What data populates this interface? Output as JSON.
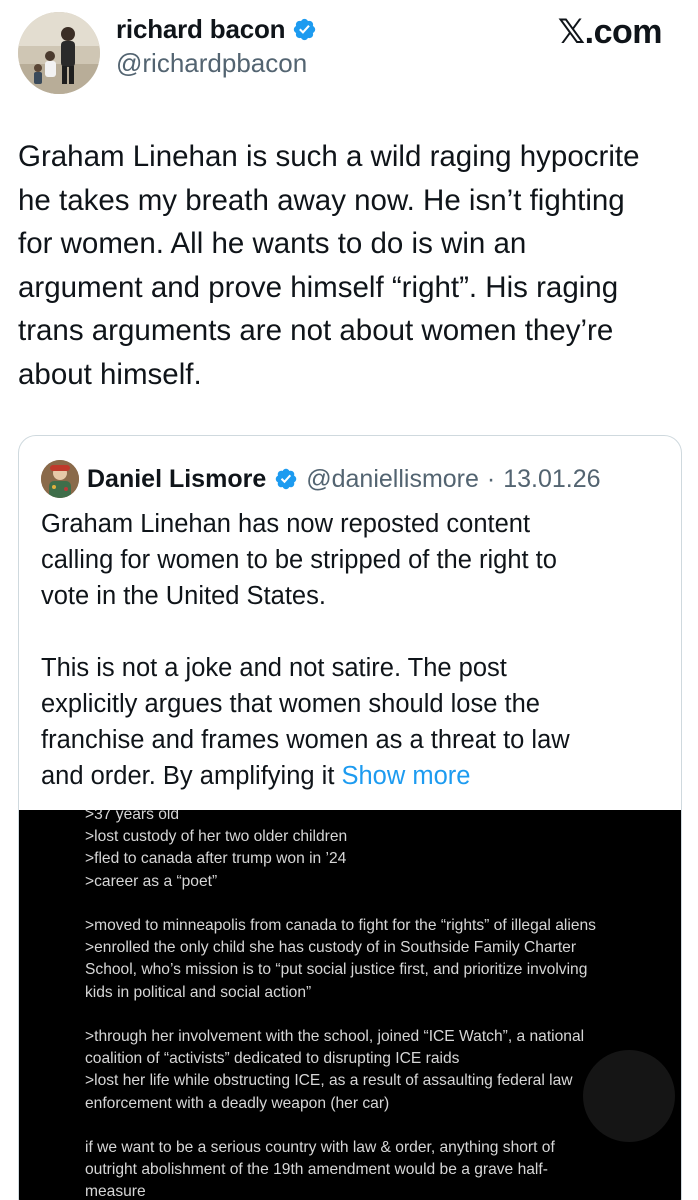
{
  "author": {
    "name": "richard bacon",
    "handle": "@richardpbacon",
    "avatar_icon": "avatar-photo-icon"
  },
  "brand": {
    "logo_text": "𝕏.com"
  },
  "tweet": {
    "text": "Graham Linehan is such a wild raging hypocrite\nhe takes my breath away now. He isn’t fighting\nfor women. All he wants to do is win an\nargument and prove himself “right”. His raging\ntrans arguments are not about women they’re\nabout himself."
  },
  "quoted": {
    "name": "Daniel Lismore",
    "handle": "@daniellismore",
    "separator": "·",
    "date": "13.01.26",
    "text": "Graham Linehan has now reposted content\ncalling for women to be stripped of the right to\nvote in the United States.\n\nThis is not a joke and not satire. The post\nexplicitly argues that women should lose the\nfranchise and frames women as a threat to law\nand order. By amplifying it ",
    "show_more": "Show more",
    "media_text": ">37 years old\n>lost custody of her two older children\n>fled to canada after trump won in ’24\n>career as a “poet”\n\n>moved to minneapolis from canada to fight for the “rights” of illegal aliens\n>enrolled the only child she has custody of in Southside Family Charter\nSchool, who’s mission is to “put social justice first, and prioritize involving\nkids in political and social action”\n\n>through her involvement with the school, joined “ICE Watch”, a national\ncoalition of “activists” dedicated to disrupting ICE raids\n>lost her life while obstructing ICE, as a result of assaulting federal law\nenforcement with a deadly weapon (her car)\n\nif we want to be a serious country with law & order, anything short of\noutright abolishment of the 19th amendment would be a grave half-\nmeasure"
  },
  "colors": {
    "text": "#0f1419",
    "secondary": "#536471",
    "link": "#1d9bf0",
    "verified": "#1d9bf0",
    "border": "#cfd9de",
    "media_bg": "#000000"
  }
}
